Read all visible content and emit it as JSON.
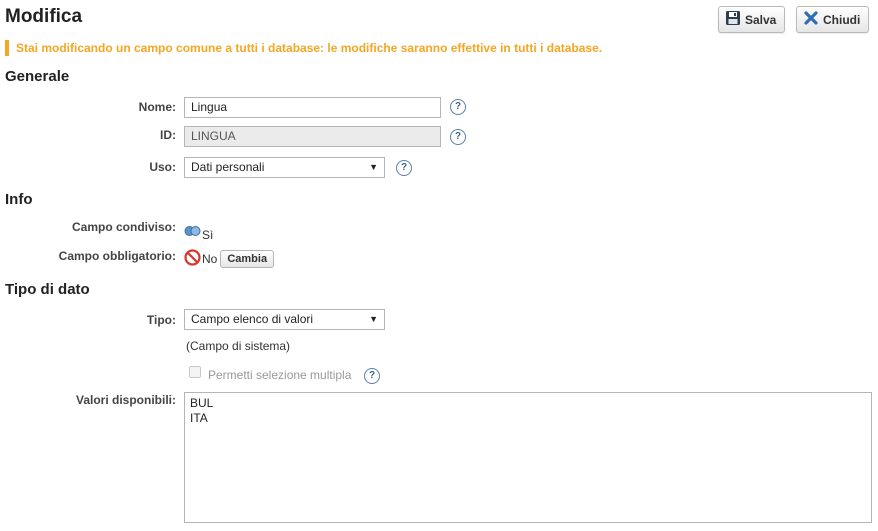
{
  "header": {
    "title": "Modifica",
    "save_label": "Salva",
    "close_label": "Chiudi"
  },
  "warning": "Stai modificando un campo comune a tutti i database: le modifiche saranno effettive in tutti i database.",
  "sections": {
    "general": "Generale",
    "info": "Info",
    "data_type": "Tipo di dato"
  },
  "general": {
    "name_label": "Nome:",
    "name_value": "Lingua",
    "id_label": "ID:",
    "id_value": "LINGUA",
    "use_label": "Uso:",
    "use_value": "Dati personali"
  },
  "info": {
    "shared_label": "Campo condiviso:",
    "shared_value": "Sì",
    "required_label": "Campo obbligatorio:",
    "required_value": "No",
    "change_label": "Cambia"
  },
  "data_type": {
    "type_label": "Tipo:",
    "type_value": "Campo elenco di valori",
    "system_note": "(Campo di sistema)",
    "multi_select_label": "Permetti selezione multipla",
    "values_label": "Valori disponibili:",
    "values": [
      "BUL",
      "ITA"
    ]
  },
  "icons": {
    "save": "floppy-disk-icon",
    "close": "x-icon",
    "help": "question-mark-icon",
    "shared": "linked-circles-icon",
    "required": "prohibited-icon"
  },
  "colors": {
    "warning": "#f5a623",
    "help": "#3d6591",
    "prohibited": "#d9362b",
    "close_icon": "#2f6db5"
  }
}
